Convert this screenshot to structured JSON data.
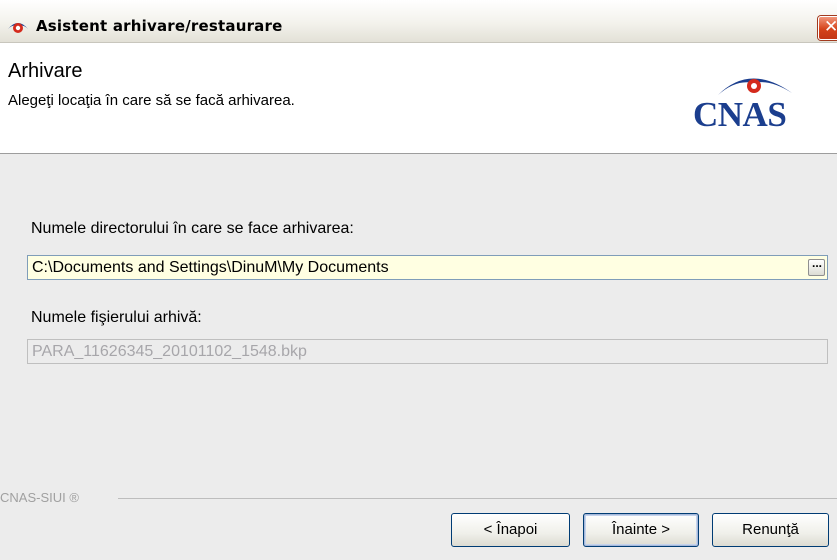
{
  "window": {
    "title": "Asistent arhivare/restaurare",
    "close_label": "✕"
  },
  "header": {
    "title": "Arhivare",
    "subtitle": "Alegeţi locaţia în care să se facă arhivarea.",
    "logo_text": "CNAS"
  },
  "form": {
    "dir_label": "Numele directorului în care se face arhivarea:",
    "dir_value": "C:\\Documents and Settings\\DinuM\\My Documents",
    "browse_label": "...",
    "file_label": "Numele fişierului arhivă:",
    "file_value": "PARA_11626345_20101102_1548.bkp"
  },
  "footer": {
    "brand": "CNAS-SIUI ®"
  },
  "buttons": {
    "back": "< Înapoi",
    "next": "Înainte >",
    "cancel": "Renunţă"
  },
  "colors": {
    "accent": "#1b3e8e",
    "logo_red": "#d42a1c",
    "input_bg": "#ffffe2"
  }
}
